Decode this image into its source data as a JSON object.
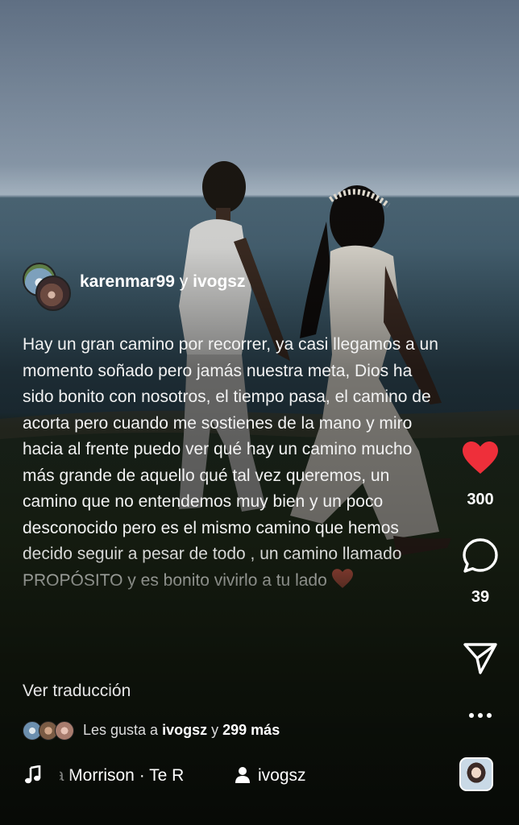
{
  "post": {
    "authors": {
      "first": "karenmar99",
      "joiner": "y",
      "second": "ivogsz"
    },
    "caption": "Hay un gran camino por recorrer, ya casi llegamos a un momento soñado pero jamás nuestra meta, Dios ha sido bonito con nosotros, el tiempo pasa, el camino de acorta pero cuando me sostienes de la mano y miro hacia al frente puedo ver qué hay un camino mucho más grande de aquello qué tal vez queremos, un camino que no entendemos muy bien y un poco desconocido pero es el mismo camino que hemos decido seguir a pesar de todo , un camino llamado PROPÓSITO y es bonito vivirlo a tu lado",
    "caption_emoji": "red-heart-emoji",
    "translate_label": "Ver traducción",
    "liked_by": {
      "prefix": "Les gusta a",
      "user": "ivogsz",
      "joiner": "y",
      "others": "299 más"
    },
    "audio": {
      "song": "rla Morrison · Te R",
      "owner": "ivogsz",
      "icon": "music-note-icon",
      "owner_icon": "person-icon"
    }
  },
  "actions": {
    "likes": "300",
    "comments": "39",
    "like_icon": "heart-icon",
    "comment_icon": "comment-icon",
    "share_icon": "share-icon",
    "more_icon": "more-icon",
    "like_color": "#ee2f3a"
  }
}
